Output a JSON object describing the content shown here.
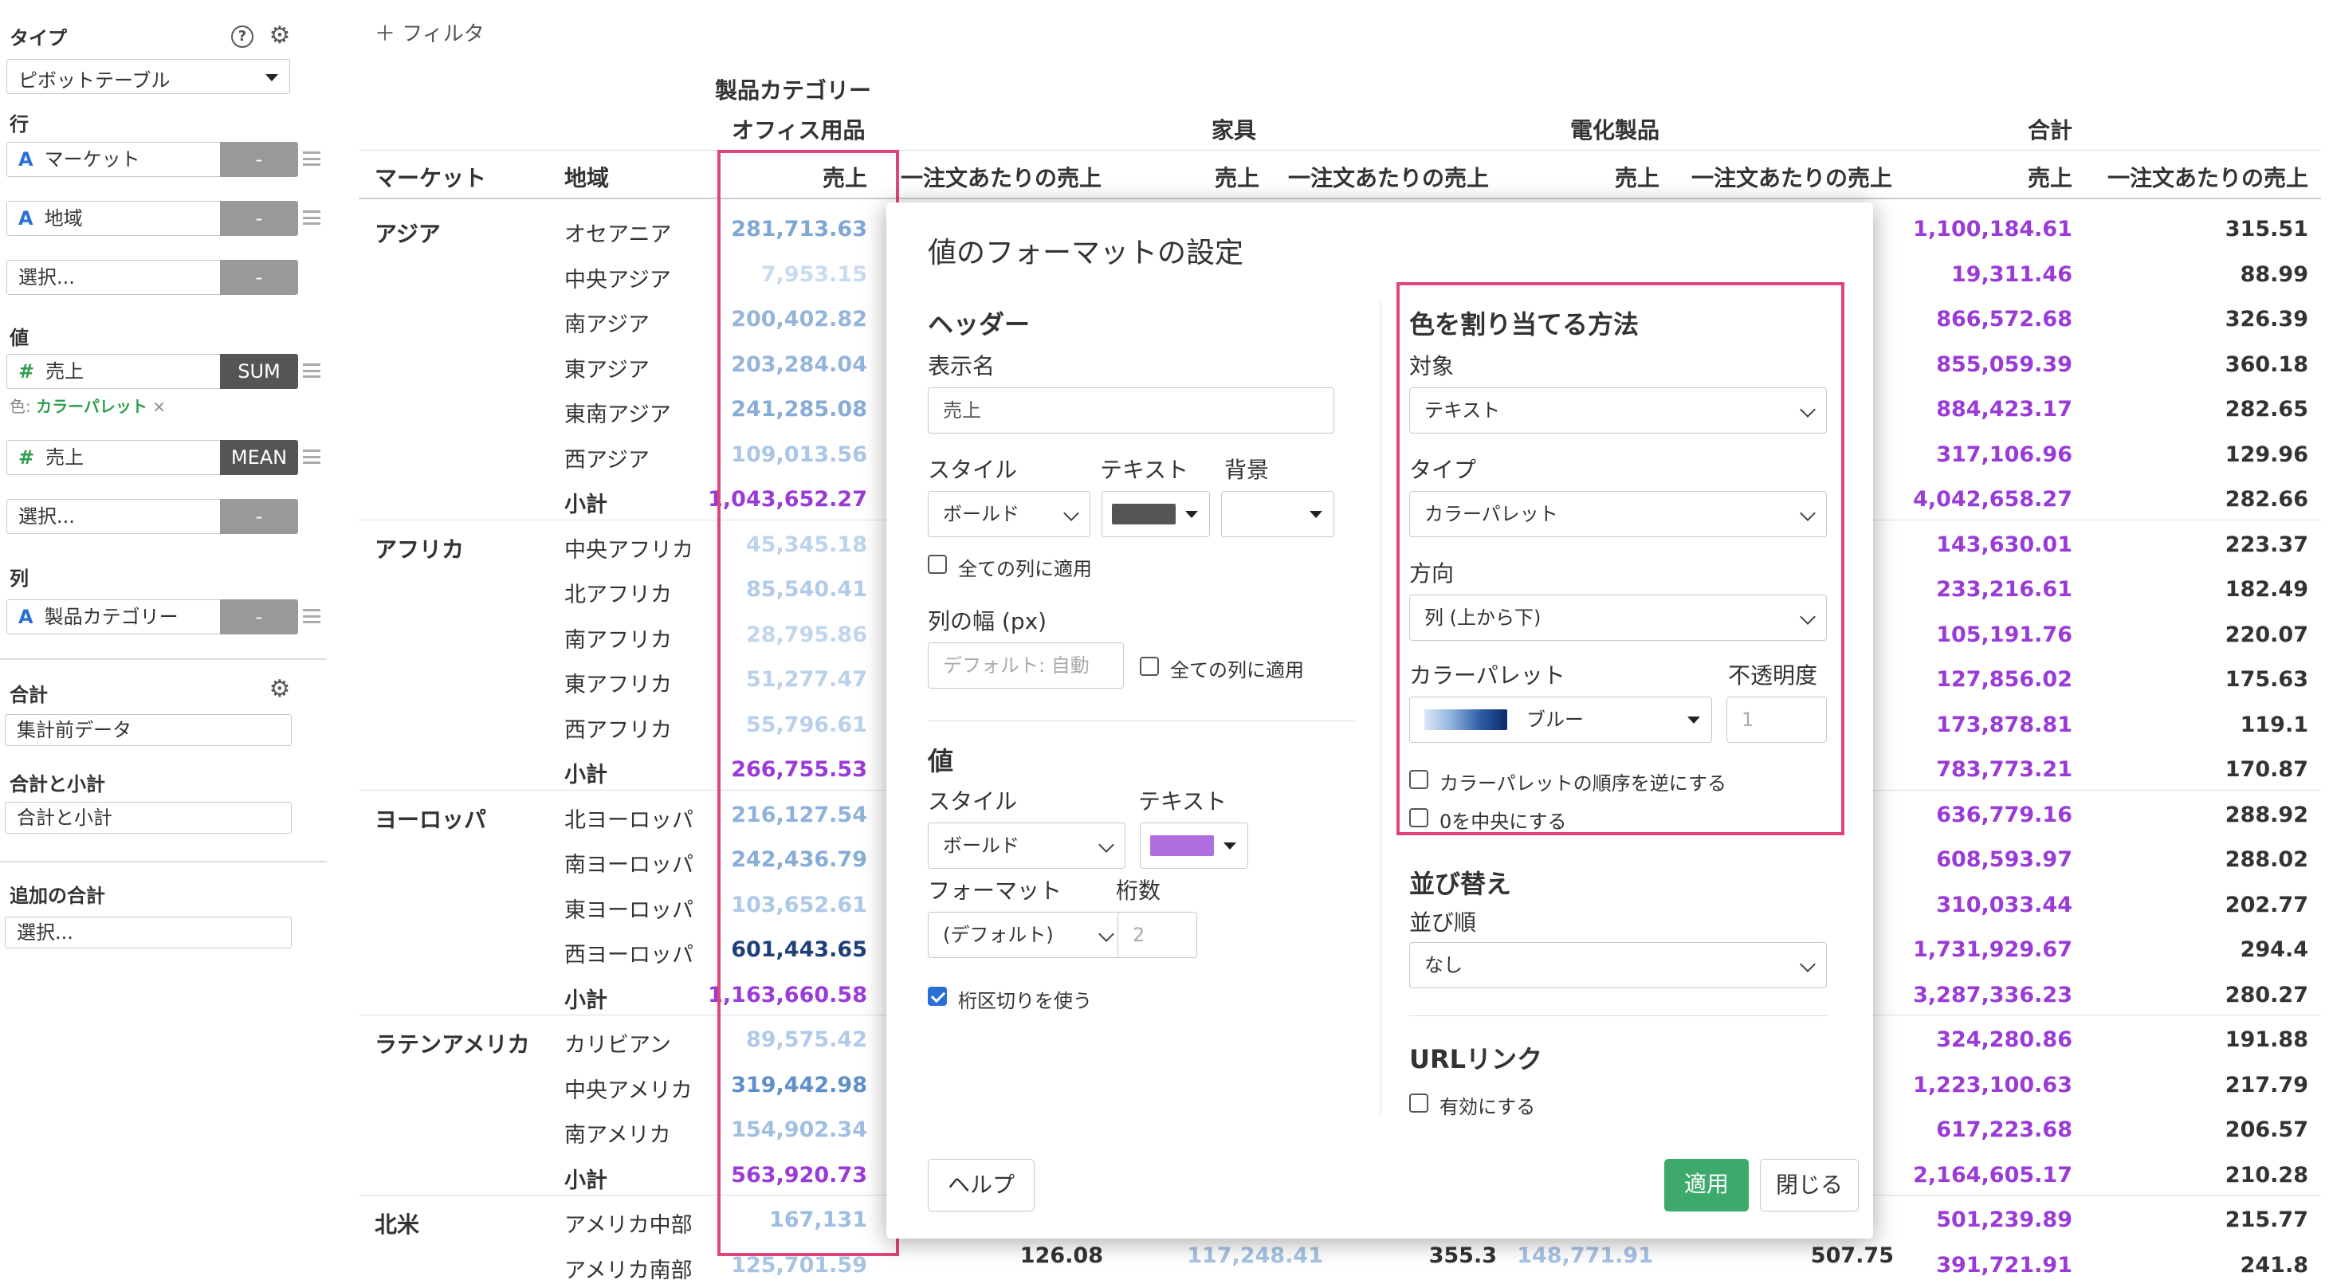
{
  "sidebar": {
    "type_label": "タイプ",
    "type_value": "ピボットテーブル",
    "rows_label": "行",
    "row_fields": [
      {
        "icon": "A",
        "name": "マーケット",
        "tag": "-"
      },
      {
        "icon": "A",
        "name": "地域",
        "tag": "-"
      }
    ],
    "row_select": "選択...",
    "row_select_tag": "-",
    "values_label": "値",
    "value_fields": [
      {
        "icon": "#",
        "name": "売上",
        "tag": "SUM"
      },
      {
        "icon": "#",
        "name": "売上",
        "tag": "MEAN"
      }
    ],
    "color_prefix": "色:",
    "color_value": "カラーパレット",
    "color_remove": "×",
    "value_select": "選択...",
    "value_select_tag": "-",
    "cols_label": "列",
    "col_field": {
      "icon": "A",
      "name": "製品カテゴリー",
      "tag": "-"
    },
    "total_label": "合計",
    "total_value": "集計前データ",
    "subtotal_label": "合計と小計",
    "subtotal_value": "合計と小計",
    "extra_label": "追加の合計",
    "extra_value": "選択...",
    "help_glyph": "?",
    "gear_glyph": "⚙"
  },
  "toolbar": {
    "filter_label": "＋ フィルタ"
  },
  "table": {
    "col_group_label": "製品カテゴリー",
    "categories": [
      "オフィス用品",
      "家具",
      "電化製品",
      "合計"
    ],
    "row_headers": [
      "マーケット",
      "地域"
    ],
    "metric_headers": [
      "売上",
      "一注文あたりの売上",
      "売上",
      "一注文あたりの売上",
      "売上",
      "一注文あたりの売上",
      "売上",
      "一注文あたりの売上"
    ],
    "rows": [
      {
        "market": "アジア",
        "region": "オセアニア",
        "office": "281,713.63",
        "office_color": "#7fa7d4",
        "total": "1,100,184.61",
        "avg": "315.51"
      },
      {
        "market": "",
        "region": "中央アジア",
        "office": "7,953.15",
        "office_color": "#c9dbef",
        "total": "19,311.46",
        "avg": "88.99"
      },
      {
        "market": "",
        "region": "南アジア",
        "office": "200,402.82",
        "office_color": "#93b5dc",
        "total": "866,572.68",
        "avg": "326.39"
      },
      {
        "market": "",
        "region": "東アジア",
        "office": "203,284.04",
        "office_color": "#93b5dc",
        "total": "855,059.39",
        "avg": "360.18"
      },
      {
        "market": "",
        "region": "東南アジア",
        "office": "241,285.08",
        "office_color": "#86acd8",
        "total": "884,423.17",
        "avg": "282.65"
      },
      {
        "market": "",
        "region": "西アジア",
        "office": "109,013.56",
        "office_color": "#aac6e6",
        "total": "317,106.96",
        "avg": "129.96"
      },
      {
        "market": "",
        "region": "小計",
        "office": "1,043,652.27",
        "office_color": "#9a3bd6",
        "total": "4,042,658.27",
        "avg": "282.66",
        "subtotal": true
      },
      {
        "market": "アフリカ",
        "region": "中央アフリカ",
        "office": "45,345.18",
        "office_color": "#bcd3ec",
        "total": "143,630.01",
        "avg": "223.37"
      },
      {
        "market": "",
        "region": "北アフリカ",
        "office": "85,540.41",
        "office_color": "#b1cbe8",
        "total": "233,216.61",
        "avg": "182.49"
      },
      {
        "market": "",
        "region": "南アフリカ",
        "office": "28,795.86",
        "office_color": "#c1d6ed",
        "total": "105,191.76",
        "avg": "220.07"
      },
      {
        "market": "",
        "region": "東アフリカ",
        "office": "51,277.47",
        "office_color": "#bad1eb",
        "total": "127,856.02",
        "avg": "175.63"
      },
      {
        "market": "",
        "region": "西アフリカ",
        "office": "55,796.61",
        "office_color": "#b8d0ea",
        "total": "173,878.81",
        "avg": "119.1"
      },
      {
        "market": "",
        "region": "小計",
        "office": "266,755.53",
        "office_color": "#9a3bd6",
        "total": "783,773.21",
        "avg": "170.87",
        "subtotal": true
      },
      {
        "market": "ヨーロッパ",
        "region": "北ヨーロッパ",
        "office": "216,127.54",
        "office_color": "#8fb2db",
        "total": "636,779.16",
        "avg": "288.92"
      },
      {
        "market": "",
        "region": "南ヨーロッパ",
        "office": "242,436.79",
        "office_color": "#86acd8",
        "total": "608,593.97",
        "avg": "288.02"
      },
      {
        "market": "",
        "region": "東ヨーロッパ",
        "office": "103,652.61",
        "office_color": "#acc8e7",
        "total": "310,033.44",
        "avg": "202.77"
      },
      {
        "market": "",
        "region": "西ヨーロッパ",
        "office": "601,443.65",
        "office_color": "#1f3f7a",
        "total": "1,731,929.67",
        "avg": "294.4"
      },
      {
        "market": "",
        "region": "小計",
        "office": "1,163,660.58",
        "office_color": "#9a3bd6",
        "total": "3,287,336.23",
        "avg": "280.27",
        "subtotal": true
      },
      {
        "market": "ラテンアメリカ",
        "region": "カリビアン",
        "office": "89,575.42",
        "office_color": "#b0cae8",
        "total": "324,280.86",
        "avg": "191.88"
      },
      {
        "market": "",
        "region": "中央アメリカ",
        "office": "319,442.98",
        "office_color": "#5f8fc9",
        "total": "1,223,100.63",
        "avg": "217.79"
      },
      {
        "market": "",
        "region": "南アメリカ",
        "office": "154,902.34",
        "office_color": "#a1bfe2",
        "total": "617,223.68",
        "avg": "206.57"
      },
      {
        "market": "",
        "region": "小計",
        "office": "563,920.73",
        "office_color": "#9a3bd6",
        "total": "2,164,605.17",
        "avg": "210.28",
        "subtotal": true
      },
      {
        "market": "北米",
        "region": "アメリカ中部",
        "office": "167,131",
        "office_color": "#9ebde1",
        "total": "501,239.89",
        "avg": "215.77"
      },
      {
        "market": "",
        "region": "アメリカ南部",
        "office": "125,701.59",
        "office_color": "#a6c3e4",
        "total": "391,721.91",
        "avg": "241.8"
      }
    ],
    "last_row_peek": {
      "c1": "126.08",
      "c2": "117,248.41",
      "c3": "355.3",
      "c4": "148,771.91",
      "c5": "507.75"
    }
  },
  "dialog": {
    "title": "値のフォーマットの設定",
    "header_section": "ヘッダー",
    "display_name_label": "表示名",
    "display_name_value": "売上",
    "style_label": "スタイル",
    "text_label": "テキスト",
    "bg_label": "背景",
    "style_value": "ボールド",
    "apply_all_cols": "全ての列に適用",
    "col_width_label": "列の幅 (px)",
    "col_width_placeholder": "デフォルト: 自動",
    "apply_all_cols2": "全ての列に適用",
    "value_section": "値",
    "v_style_label": "スタイル",
    "v_text_label": "テキスト",
    "v_style_value": "ボールド",
    "format_label": "フォーマット",
    "digits_label": "桁数",
    "format_value": "(デフォルト)",
    "digits_value": "2",
    "thousand_sep": "桁区切りを使う",
    "help_button": "ヘルプ",
    "color_section": "色を割り当てる方法",
    "target_label": "対象",
    "target_value": "テキスト",
    "type_label": "タイプ",
    "type_value": "カラーパレット",
    "direction_label": "方向",
    "direction_value": "列 (上から下)",
    "palette_label": "カラーパレット",
    "opacity_label": "不透明度",
    "palette_value": "ブルー",
    "opacity_value": "1",
    "reverse_palette": "カラーパレットの順序を逆にする",
    "zero_center": "0を中央にする",
    "sort_section": "並び替え",
    "sort_order_label": "並び順",
    "sort_order_value": "なし",
    "url_section": "URLリンク",
    "url_enable": "有効にする",
    "apply_button": "適用",
    "close_button": "閉じる"
  },
  "colors": {
    "accent_green": "#3daa6b",
    "highlight_pink": "#e0457a",
    "subtotal_purple": "#9a3bd6",
    "header_text_swatch": "#555555",
    "value_text_swatch": "#b06fe0",
    "brand_blue": "#2a6fd6"
  }
}
